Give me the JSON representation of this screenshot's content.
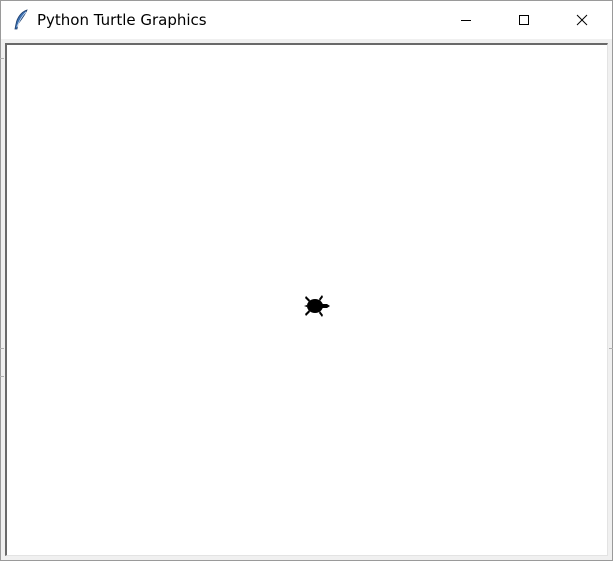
{
  "window": {
    "title": "Python Turtle Graphics",
    "icon": "tk-feather-icon",
    "controls": {
      "minimize": "minimize-icon",
      "maximize": "maximize-icon",
      "close": "close-icon"
    }
  },
  "canvas": {
    "background": "#ffffff",
    "turtle": {
      "shape": "turtle-icon",
      "color": "#000000",
      "heading": "east"
    }
  }
}
